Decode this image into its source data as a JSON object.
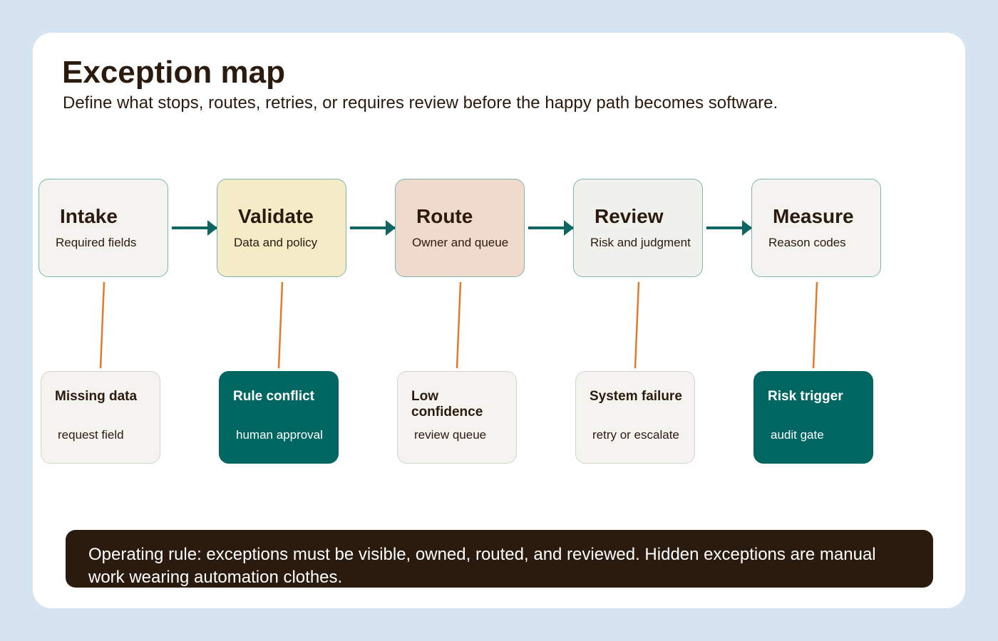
{
  "header": {
    "title": "Exception map",
    "subtitle": "Define what stops, routes, retries, or requires review before the happy path becomes software."
  },
  "colors": {
    "background": "#d5e4f0",
    "ink": "#2b1a0e",
    "flow_arrow": "#0d6661",
    "exception_link": "#e07b2e",
    "accent_teal": "#006661",
    "neutral_step": "#f4f3ef",
    "validate_step": "#f3ecc7",
    "route_step": "#f0dacc"
  },
  "steps": [
    {
      "title": "Intake",
      "subtitle": "Required fields",
      "fill": "#f4f3ef"
    },
    {
      "title": "Validate",
      "subtitle": "Data and policy",
      "fill": "#f3ecc7"
    },
    {
      "title": "Route",
      "subtitle": "Owner and queue",
      "fill": "#f0dacc"
    },
    {
      "title": "Review",
      "subtitle": "Risk and judgment",
      "fill": "#f0f0ec"
    },
    {
      "title": "Measure",
      "subtitle": "Reason codes",
      "fill": "#f4f3ef"
    }
  ],
  "exceptions": [
    {
      "title": "Missing data",
      "action": "request field",
      "style": "light"
    },
    {
      "title": "Rule conflict",
      "action": "human approval",
      "style": "dark"
    },
    {
      "title": "Low confidence",
      "action": "review queue",
      "style": "light"
    },
    {
      "title": "System failure",
      "action": "retry or escalate",
      "style": "light"
    },
    {
      "title": "Risk trigger",
      "action": "audit gate",
      "style": "dark"
    }
  ],
  "rule": {
    "text": "Operating rule: exceptions must be visible, owned, routed, and reviewed. Hidden exceptions are manual work wearing automation clothes."
  }
}
